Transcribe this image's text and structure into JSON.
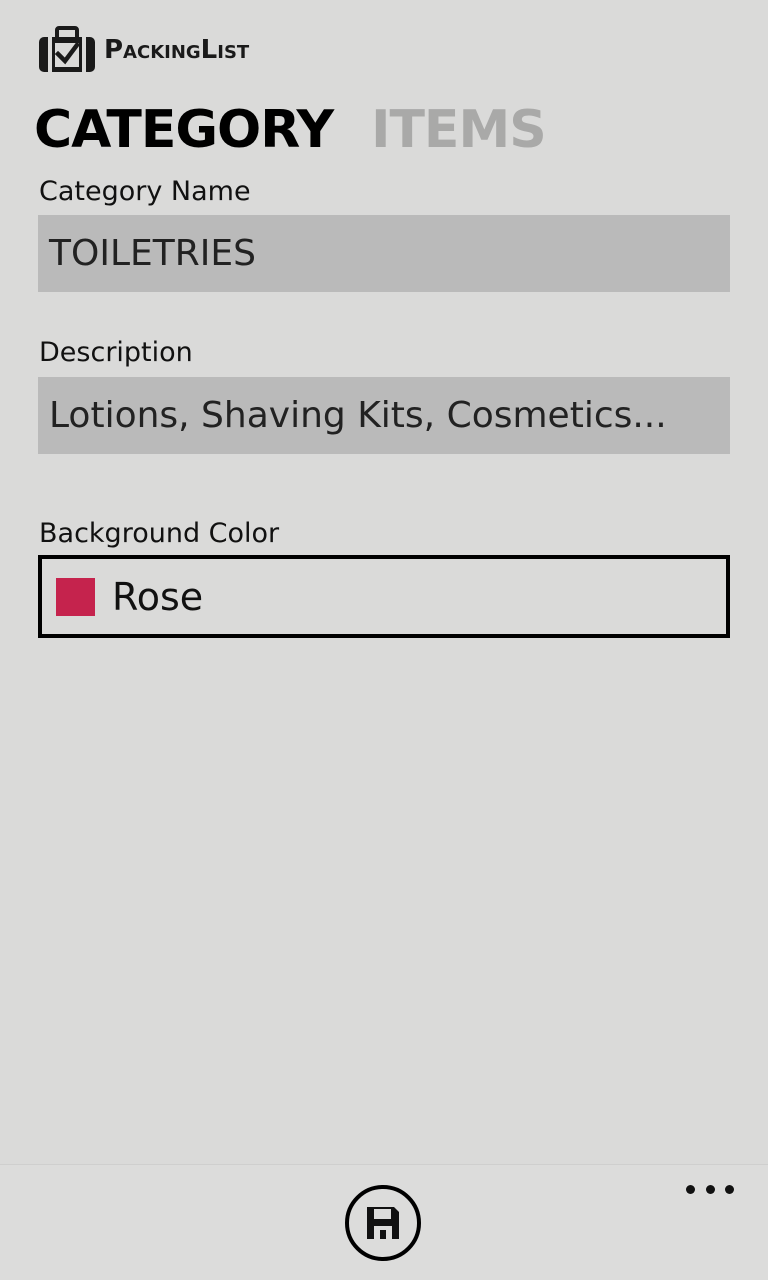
{
  "app": {
    "title": "PackingList",
    "logo_icon": "suitcase-check-icon"
  },
  "pivot": {
    "tabs": [
      {
        "label": "CATEGORY",
        "active": true
      },
      {
        "label": "ITEMS",
        "active": false
      }
    ]
  },
  "form": {
    "category_name": {
      "label": "Category Name",
      "value": "TOILETRIES"
    },
    "description": {
      "label": "Description",
      "value": "Lotions, Shaving Kits, Cosmetics..."
    },
    "background_color": {
      "label": "Background Color",
      "selected": "Rose",
      "swatch_color": "#c5234d"
    }
  },
  "app_bar": {
    "save_icon": "save-icon",
    "more_icon": "more-icon"
  },
  "colors": {
    "background": "#dadad9",
    "field_background": "#bababa",
    "inactive_tab": "#a9a9a8"
  }
}
